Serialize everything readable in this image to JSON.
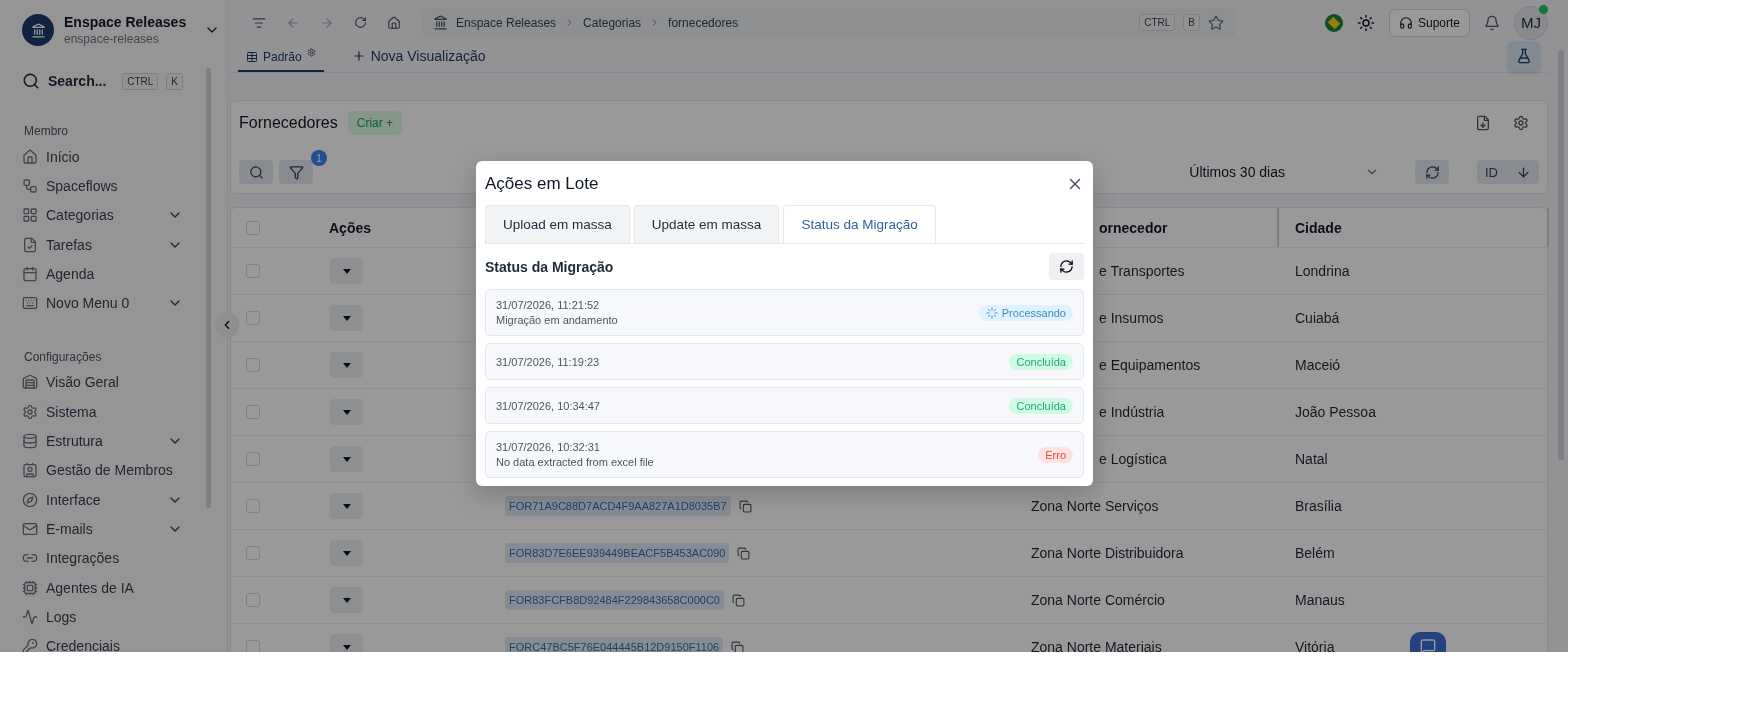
{
  "sidebar": {
    "workspace": {
      "name": "Enspace Releases",
      "slug": "enspace-releases"
    },
    "search": {
      "placeholder": "Search...",
      "keys": [
        "CTRL",
        "K"
      ]
    },
    "sections": [
      {
        "title": "Membro",
        "items": [
          {
            "label": "Início",
            "kind": "link"
          },
          {
            "label": "Spaceflows",
            "kind": "link"
          },
          {
            "label": "Categorias",
            "kind": "group"
          },
          {
            "label": "Tarefas",
            "kind": "group"
          },
          {
            "label": "Agenda",
            "kind": "link"
          },
          {
            "label": "Novo Menu 0",
            "kind": "group"
          }
        ]
      },
      {
        "title": "Configurações",
        "items": [
          {
            "label": "Visão Geral",
            "kind": "link"
          },
          {
            "label": "Sistema",
            "kind": "link"
          },
          {
            "label": "Estrutura",
            "kind": "group"
          },
          {
            "label": "Gestão de Membros",
            "kind": "link"
          },
          {
            "label": "Interface",
            "kind": "group"
          },
          {
            "label": "E-mails",
            "kind": "group"
          },
          {
            "label": "Integrações",
            "kind": "link"
          },
          {
            "label": "Agentes de IA",
            "kind": "link"
          },
          {
            "label": "Logs",
            "kind": "link"
          },
          {
            "label": "Credenciais",
            "kind": "link"
          }
        ]
      }
    ]
  },
  "topbar": {
    "breadcrumb": [
      "Enspace Releases",
      "Categorias",
      "fornecedores"
    ],
    "shortcut_keys": [
      "CTRL",
      "B"
    ],
    "support": "Suporte",
    "avatar": {
      "initials": "MJ",
      "online": true
    }
  },
  "views": [
    {
      "label": "Padrão",
      "kind": "view",
      "selected": true
    },
    {
      "label": "Nova Visualização",
      "kind": "add",
      "selected": false
    }
  ],
  "card": {
    "title": "Fornecedores",
    "create_button": "Criar +",
    "filter_count": "1",
    "date_range": "Últimos 30 dias",
    "sort_field": "ID"
  },
  "table": {
    "header_checked": false,
    "columns": [
      "Ações",
      "ornecedor",
      "Cidade"
    ],
    "rows": [
      {
        "checked": false,
        "fornecedor": "e Transportes",
        "cidade": "Londrina"
      },
      {
        "checked": false,
        "fornecedor": "e Insumos",
        "cidade": "Cuiabá"
      },
      {
        "checked": false,
        "fornecedor": "e Equipamentos",
        "cidade": "Maceió"
      },
      {
        "checked": false,
        "fornecedor": "e Indústria",
        "cidade": "João Pessoa"
      },
      {
        "checked": false,
        "fornecedor": "e Logística",
        "cidade": "Natal"
      },
      {
        "checked": false,
        "id": "FOR71A9C88D7ACD4F9AA827A1D8035B7",
        "fornecedor": "Zona Norte Serviços",
        "cidade": "Brasília"
      },
      {
        "checked": false,
        "id": "FOR83D7E6EE939449BEACF5B453AC090",
        "fornecedor": "Zona Norte Distribuidora",
        "cidade": "Belém"
      },
      {
        "checked": false,
        "id": "FOR83FCFB8D92484F229843658C000C0",
        "fornecedor": "Zona Norte Comércio",
        "cidade": "Manaus"
      },
      {
        "checked": false,
        "id": "FORC47BC5F76E044445B12D9150F1106",
        "fornecedor": "Zona Norte Materiais",
        "cidade": "Vitória"
      }
    ]
  },
  "dialog": {
    "title": "Ações em Lote",
    "tabs": [
      {
        "label": "Upload em massa",
        "selected": false
      },
      {
        "label": "Update em massa",
        "selected": false
      },
      {
        "label": "Status da Migração",
        "selected": true
      }
    ],
    "section_title": "Status da Migração",
    "items": [
      {
        "datetime": "31/07/2026, 11:21:52",
        "message": "Migração em andamento",
        "status": {
          "label": "Processando",
          "kind": "processing"
        }
      },
      {
        "datetime": "31/07/2026, 11:19:23",
        "status": {
          "label": "Concluída",
          "kind": "done"
        }
      },
      {
        "datetime": "31/07/2026, 10:34:47",
        "status": {
          "label": "Concluída",
          "kind": "done"
        }
      },
      {
        "datetime": "31/07/2026, 10:32:31",
        "message": "No data extracted from excel file",
        "status": {
          "label": "Erro",
          "kind": "error"
        }
      }
    ]
  }
}
